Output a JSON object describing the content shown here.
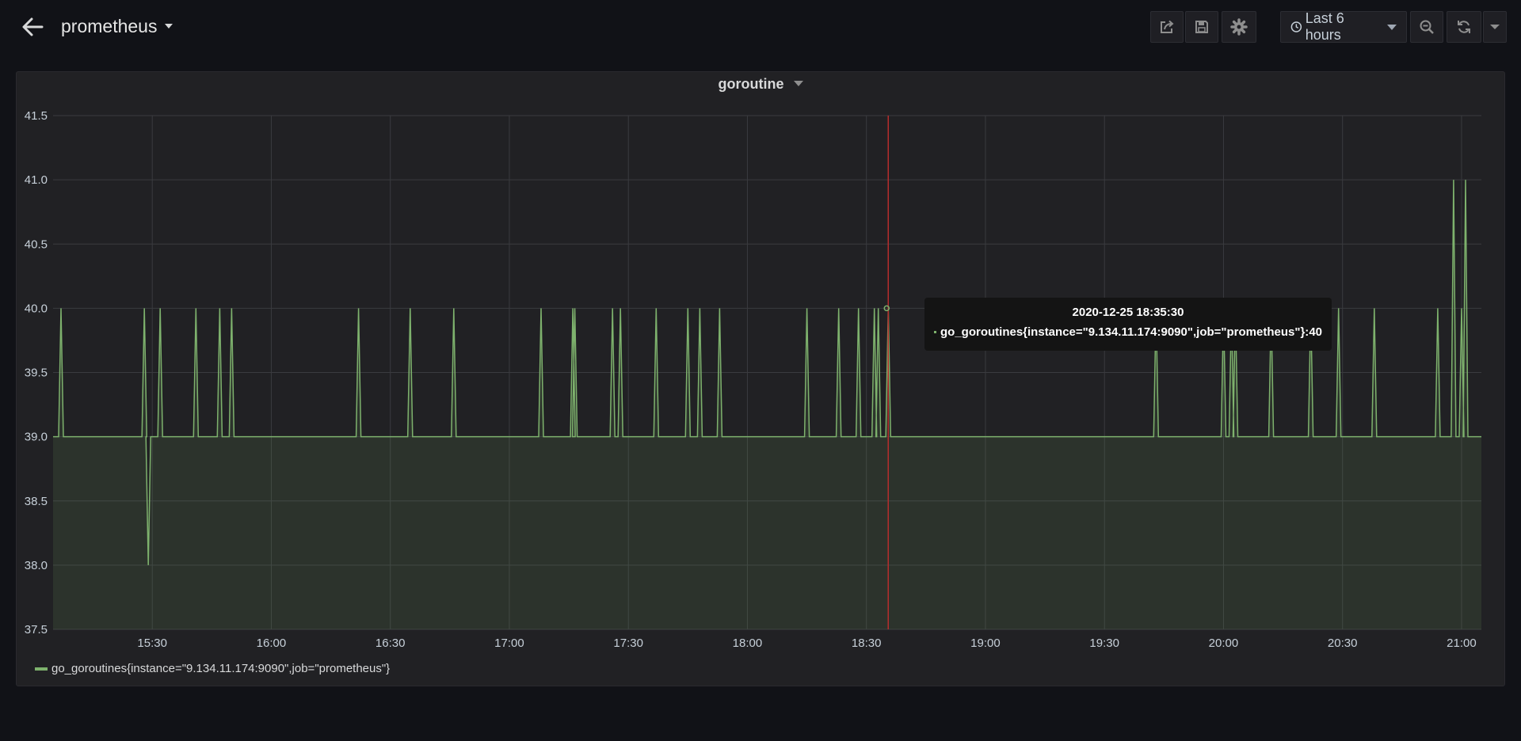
{
  "header": {
    "dashboard_title": "prometheus",
    "time_range_label": "Last 6 hours",
    "icons": {
      "back": "arrow-left-icon",
      "share": "share-icon",
      "save": "save-icon",
      "settings": "gear-icon",
      "clock": "clock-icon",
      "zoom_out": "zoom-out-icon",
      "refresh": "refresh-icon",
      "refresh_interval": "chevron-down-icon"
    }
  },
  "panel": {
    "title": "goroutine"
  },
  "tooltip": {
    "time": "2020-12-25 18:35:30",
    "series": "go_goroutines{instance=\"9.134.11.174:9090\",job=\"prometheus\"}:",
    "value": "40"
  },
  "legend": {
    "series": "go_goroutines{instance=\"9.134.11.174:9090\",job=\"prometheus\"}"
  },
  "colors": {
    "background": "#111217",
    "panel": "#212124",
    "series": "#7eb26d",
    "crosshair": "#b52d2d"
  },
  "chart_data": {
    "type": "area",
    "title": "goroutine",
    "x_ticks": [
      "15:30",
      "16:00",
      "16:30",
      "17:00",
      "17:30",
      "18:00",
      "18:30",
      "19:00",
      "19:30",
      "20:00",
      "20:30",
      "21:00"
    ],
    "y_ticks": [
      "37.5",
      "38.0",
      "38.5",
      "39.0",
      "39.5",
      "40.0",
      "40.5",
      "41.0",
      "41.5"
    ],
    "xlim": [
      "15:05",
      "21:05"
    ],
    "ylim": [
      37.5,
      41.5
    ],
    "grid": true,
    "legend_position": "bottom-left",
    "hover_time": "18:35:30",
    "series": [
      {
        "name": "go_goroutines{instance=\"9.134.11.174:9090\",job=\"prometheus\"}",
        "baseline": 39,
        "spikes": [
          {
            "t": "15:07",
            "v": 40
          },
          {
            "t": "15:28",
            "v": 40
          },
          {
            "t": "15:29",
            "v": 38
          },
          {
            "t": "15:32",
            "v": 40
          },
          {
            "t": "15:41",
            "v": 40
          },
          {
            "t": "15:47",
            "v": 40
          },
          {
            "t": "15:50",
            "v": 40
          },
          {
            "t": "16:22",
            "v": 40
          },
          {
            "t": "16:35",
            "v": 40
          },
          {
            "t": "16:46",
            "v": 40
          },
          {
            "t": "17:08",
            "v": 40
          },
          {
            "t": "17:16",
            "v": 40
          },
          {
            "t": "17:16:30",
            "v": 40
          },
          {
            "t": "17:26",
            "v": 40
          },
          {
            "t": "17:28",
            "v": 40
          },
          {
            "t": "17:37",
            "v": 40
          },
          {
            "t": "17:45",
            "v": 40
          },
          {
            "t": "17:48",
            "v": 40
          },
          {
            "t": "17:53",
            "v": 40
          },
          {
            "t": "18:15",
            "v": 40
          },
          {
            "t": "18:23",
            "v": 40
          },
          {
            "t": "18:28",
            "v": 40
          },
          {
            "t": "18:32",
            "v": 40
          },
          {
            "t": "18:33",
            "v": 40
          },
          {
            "t": "18:35:30",
            "v": 40
          },
          {
            "t": "19:43",
            "v": 40
          },
          {
            "t": "20:00",
            "v": 40
          },
          {
            "t": "20:02",
            "v": 40
          },
          {
            "t": "20:03",
            "v": 40
          },
          {
            "t": "20:12",
            "v": 40
          },
          {
            "t": "20:22",
            "v": 40
          },
          {
            "t": "20:29",
            "v": 40
          },
          {
            "t": "20:38",
            "v": 40
          },
          {
            "t": "20:54",
            "v": 40
          },
          {
            "t": "20:58",
            "v": 41
          },
          {
            "t": "21:00",
            "v": 40
          },
          {
            "t": "21:01",
            "v": 41
          }
        ]
      }
    ]
  }
}
